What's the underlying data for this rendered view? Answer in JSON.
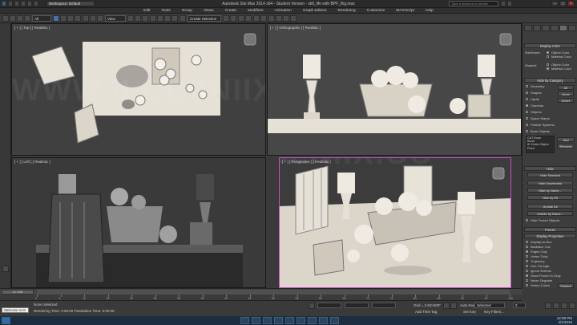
{
  "titlebar": {
    "workspace": "Workspace: Default",
    "title": "Autodesk 3ds Max  2014 x64  -  Student Version  -  still_life with BPF_fbg.max",
    "search_placeholder": "Type a keyword or phrase"
  },
  "menu": [
    "Edit",
    "Tools",
    "Group",
    "Views",
    "Create",
    "Modifiers",
    "Animation",
    "Graph Editors",
    "Rendering",
    "Customize",
    "MAXScript",
    "Help"
  ],
  "toolbar": {
    "filter": "All",
    "coordinate_system": "View",
    "selection_set": "Create Selection Se"
  },
  "viewports": {
    "top": "[ + ] [ Top ] [ Realistic ]",
    "orthographic": "[ + ] [ Orthographic ] [ Realistic ]",
    "left": "[ + ] [ Left ] [ Realistic ]",
    "perspective": "[ + ] [ Perspective ] [ Realistic ]",
    "watermark_top": "WWW.ILCCZNIIX.CO",
    "watermark_bottom": "WWW.ILCCZNIIX.CO"
  },
  "command_panel": {
    "display_color": {
      "header": "Display Color",
      "wireframe_label": "Wireframe:",
      "shaded_label": "Shaded:",
      "object_color": "Object Color",
      "material_color": "Material Color"
    },
    "hide_by_category": {
      "header": "Hide by Category",
      "categories": [
        "Geometry",
        "Shapes",
        "Lights",
        "Cameras",
        "Helpers",
        "Space Warps",
        "Particle Systems",
        "Bone Objects"
      ],
      "all_label": "All",
      "none_label": "None",
      "invert_label": "Invert",
      "list": [
        "CAT Bone",
        "Bone",
        "IK Chain Object",
        "Point"
      ],
      "add_label": "Add",
      "remove_label": "Remove"
    },
    "hide": {
      "header": "Hide",
      "buttons": [
        "Hide Selected",
        "Hide Unselected",
        "Hide by Name...",
        "Hide by Hit",
        "Unhide All",
        "Unhide by Name..."
      ],
      "frozen_label": "Hide Frozen Objects"
    },
    "freeze": {
      "header": "Freeze"
    },
    "display_properties": {
      "header": "Display Properties",
      "items": [
        "Display as Box",
        "Backface Cull",
        "Edges Only",
        "Vertex Ticks",
        "Trajectory",
        "See-Through",
        "Ignore Extents",
        "Show Frozen in Gray",
        "Never Degrade",
        "Vertex Colors"
      ],
      "shaded_label": "Shaded"
    }
  },
  "timeline": {
    "slider": "0 / 100",
    "ticks": [
      "0",
      "5",
      "10",
      "15",
      "20",
      "25",
      "30",
      "35",
      "40",
      "45",
      "50",
      "55",
      "60",
      "65",
      "70",
      "75",
      "80",
      "85",
      "90",
      "95",
      "100"
    ]
  },
  "status": {
    "maxscript": "Welcome to M",
    "selection": "None Selected",
    "rendering_time": "Rendering Time: 0:00:00",
    "translation_time": "Translation Time: 0:00:28",
    "grid": "Grid = 2.5/0.500\"",
    "auto_key": "Auto Key",
    "selected": "Selected",
    "set_key": "Set Key",
    "key_filters": "Key Filters...",
    "add_time_tag": "Add Time Tag",
    "frame": "0"
  },
  "taskbar": {
    "time": "12:09 PM",
    "date": "4/1/2015"
  },
  "colors": {
    "accent": "#4a6fa8",
    "active_viewport": "#c84ec8",
    "swatch_magenta": "#b0407c"
  }
}
